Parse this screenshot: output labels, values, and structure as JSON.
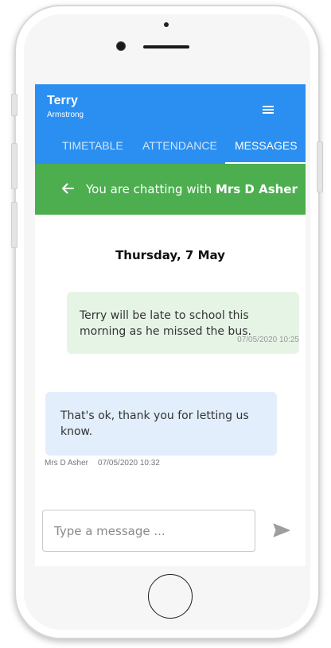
{
  "header": {
    "user_first_name": "Terry",
    "user_last_name": "Armstrong",
    "menu_icon": "hamburger-menu-icon",
    "background_color": "#2a8ff1"
  },
  "tabs": [
    {
      "label": "TIMETABLE",
      "active": false
    },
    {
      "label": "ATTENDANCE",
      "active": false
    },
    {
      "label": "MESSAGES",
      "active": true
    }
  ],
  "chat_bar": {
    "prefix": "You are chatting with",
    "contact": "Mrs D Asher",
    "back_icon": "back-arrow-icon",
    "background_color": "#4cae4f"
  },
  "conversation": {
    "date_heading": "Thursday, 7 May",
    "messages": [
      {
        "direction": "outgoing",
        "text": "Terry will be late to school this morning as he missed the bus.",
        "timestamp": "07/05/2020 10:25",
        "bubble_color": "#e6f4e6"
      },
      {
        "direction": "incoming",
        "text": "That's ok, thank you for letting us know.",
        "sender": "Mrs D Asher",
        "timestamp": "07/05/2020 10:32",
        "bubble_color": "#e2eefb"
      }
    ]
  },
  "composer": {
    "placeholder": "Type a message ...",
    "value": "",
    "send_icon": "send-icon"
  }
}
